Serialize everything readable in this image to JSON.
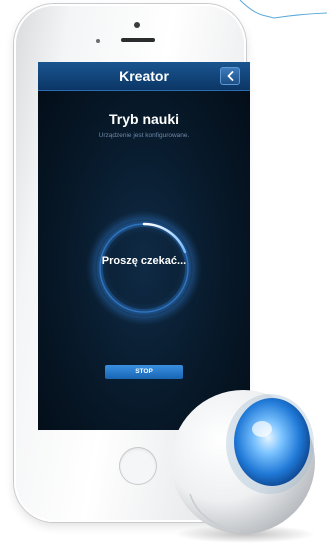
{
  "app": {
    "header_title": "Kreator",
    "back_icon": "chevron-left-icon"
  },
  "screen": {
    "title": "Tryb nauki",
    "subtitle": "Urządzenie jest konfigurowane.",
    "wait_text": "Proszę czekać...",
    "stop_label": "STOP"
  },
  "colors": {
    "header_blue": "#1a5590",
    "button_blue": "#2a7fd0",
    "screen_bg": "#071828",
    "device_glow": "#4aa3f0"
  }
}
